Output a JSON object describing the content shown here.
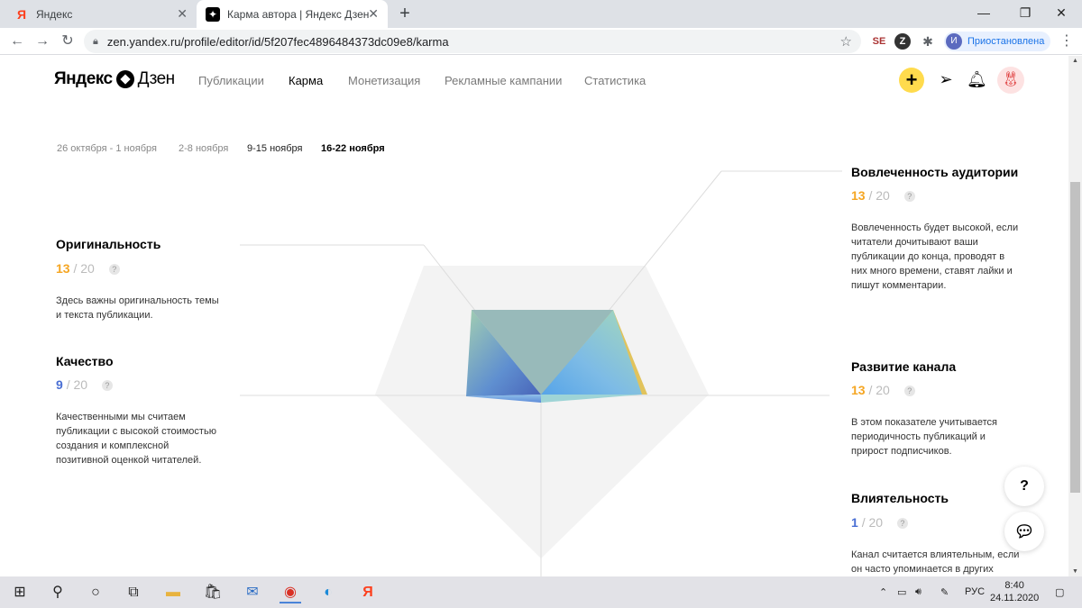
{
  "browser": {
    "tabs": [
      {
        "title": "Яндекс",
        "favicon": "yandex-icon"
      },
      {
        "title": "Карма автора | Яндекс Дзен",
        "favicon": "zen-icon"
      }
    ],
    "url": "zen.yandex.ru/profile/editor/id/5f207fec4896484373dc09e8/karma",
    "profile_initial": "И",
    "profile_status": "Приостановлена"
  },
  "header": {
    "logo_left": "Яндекс",
    "logo_right": "Дзен",
    "menu": [
      "Публикации",
      "Карма",
      "Монетизация",
      "Рекламные кампании",
      "Статистика"
    ],
    "selected_menu": "Карма"
  },
  "weeks": [
    "26 октября - 1 ноября",
    "2-8 ноября",
    "9-15 ноября",
    "16-22 ноября"
  ],
  "metrics": {
    "originality": {
      "title": "Оригинальность",
      "value": "13",
      "max": "/ 20",
      "desc": [
        "Здесь важны оригинальность темы",
        "и текста публикации."
      ],
      "color": "#f5a623"
    },
    "quality": {
      "title": "Качество",
      "value": "9",
      "max": "/ 20",
      "desc": [
        "Качественными мы считаем",
        "публикации с высокой стоимостью",
        "создания и комплексной",
        "позитивной оценкой читателей."
      ],
      "color": "#4a6fd4"
    },
    "engagement": {
      "title": "Вовлеченность аудитории",
      "value": "13",
      "max": "/ 20",
      "desc": [
        "Вовлеченность будет высокой, если",
        "читатели дочитывают ваши",
        "публикации до конца, проводят в",
        "них много времени, ставят лайки и",
        "пишут комментарии."
      ],
      "color": "#f5a623"
    },
    "growth": {
      "title": "Развитие канала",
      "value": "13",
      "max": "/ 20",
      "desc": [
        "В этом показателе учитывается",
        "периодичность публикаций и",
        "прирост подписчиков."
      ],
      "color": "#f5a623"
    },
    "influence": {
      "title": "Влиятельность",
      "value": "1",
      "max": "/ 20",
      "desc": [
        "Канал считается влиятельным, если",
        "он часто упоминается в других"
      ],
      "color": "#4a6fd4"
    }
  },
  "help_button": "?",
  "taskbar": {
    "lang": "РУС",
    "time": "8:40",
    "date": "24.11.2020"
  }
}
